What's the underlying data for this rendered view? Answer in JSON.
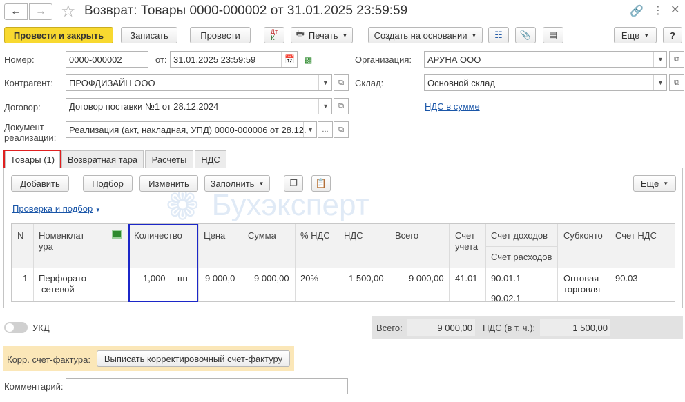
{
  "window": {
    "title": "Возврат: Товары 0000-000002 от 31.01.2025 23:59:59"
  },
  "toolbar": {
    "post_close": "Провести и закрыть",
    "save": "Записать",
    "post": "Провести",
    "dtkt_top": "Дт",
    "dtkt_bottom": "Кт",
    "print": "Печать",
    "create_based": "Создать на основании",
    "more": "Еще",
    "help": "?"
  },
  "header": {
    "number_label": "Номер:",
    "number_value": "0000-000002",
    "date_label": "от:",
    "date_value": "31.01.2025 23:59:59",
    "org_label": "Организация:",
    "org_value": "АРУНА ООО",
    "counterparty_label": "Контрагент:",
    "counterparty_value": "ПРОФДИЗАЙН ООО",
    "warehouse_label": "Склад:",
    "warehouse_value": "Основной склад",
    "contract_label": "Договор:",
    "contract_value": "Договор поставки №1 от 28.12.2024",
    "vat_link": "НДС в сумме",
    "sale_doc_label_1": "Документ",
    "sale_doc_label_2": "реализации:",
    "sale_doc_value": "Реализация (акт, накладная, УПД) 0000-000006 от 28.12.",
    "ellipsis": "..."
  },
  "tabs": [
    {
      "label": "Товары (1)"
    },
    {
      "label": "Возвратная тара"
    },
    {
      "label": "Расчеты"
    },
    {
      "label": "НДС"
    }
  ],
  "goods_toolbar": {
    "add": "Добавить",
    "pick": "Подбор",
    "change": "Изменить",
    "fill": "Заполнить",
    "more": "Еще",
    "check_link": "Проверка и подбор"
  },
  "watermark": "Бухэксперт",
  "table": {
    "headers": {
      "n": "N",
      "item_1": "Номенклат",
      "item_2": "ура",
      "qty": "Количество",
      "price": "Цена",
      "sum": "Сумма",
      "vat_rate": "% НДС",
      "vat": "НДС",
      "total": "Всего",
      "account_1": "Счет",
      "account_2": "учета",
      "income_account": "Счет доходов",
      "expense_account": "Счет расходов",
      "subconto": "Субконто",
      "vat_account": "Счет НДС"
    },
    "rows": [
      {
        "n": "1",
        "item_1": "Перфорато",
        "item_2": "сетевой",
        "qty": "1,000",
        "unit": "шт",
        "price": "9 000,0",
        "sum": "9 000,00",
        "vat_rate": "20%",
        "vat": "1 500,00",
        "total": "9 000,00",
        "account": "41.01",
        "income_account": "90.01.1",
        "expense_account": "90.02.1",
        "subconto_1": "Оптовая",
        "subconto_2": "торговля",
        "vat_account": "90.03"
      }
    ]
  },
  "footer": {
    "ukd_label": "УКД",
    "total_label": "Всего:",
    "total_value": "9 000,00",
    "vat_label": "НДС (в т. ч.):",
    "vat_value": "1 500,00",
    "invoice_label": "Корр. счет-фактура:",
    "invoice_button": "Выписать корректировочный счет-фактуру",
    "comment_label": "Комментарий:",
    "comment_value": ""
  },
  "colors": {
    "primary_button": "#f8d930",
    "link": "#1a56a8",
    "highlight_red": "#e02020",
    "highlight_blue": "#1c27c8",
    "invoice_panel": "#fbe7b8"
  }
}
